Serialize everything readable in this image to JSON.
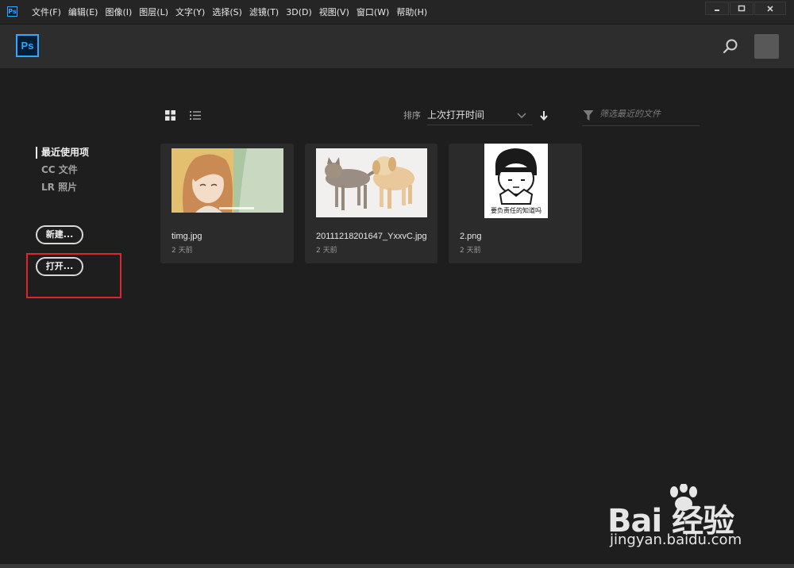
{
  "menubar": {
    "app_icon": "Ps",
    "items": [
      "文件(F)",
      "编辑(E)",
      "图像(I)",
      "图层(L)",
      "文字(Y)",
      "选择(S)",
      "滤镜(T)",
      "3D(D)",
      "视图(V)",
      "窗口(W)",
      "帮助(H)"
    ],
    "controls": [
      "minimize-icon",
      "maximize-icon",
      "close-icon"
    ]
  },
  "header": {
    "logo": "Ps",
    "icons": [
      "search-icon",
      "avatar"
    ]
  },
  "nav": {
    "items": [
      "最近使用项",
      "CC 文件",
      "LR 照片"
    ],
    "active_index": 0
  },
  "buttons": {
    "new_label": "新建...",
    "open_label": "打开..."
  },
  "toolbar": {
    "view_modes": [
      "grid-view-icon",
      "list-view-icon"
    ],
    "sort_label": "排序",
    "sort_value": "上次打开时间",
    "filter_placeholder": "筛选最近的文件"
  },
  "files": [
    {
      "name": "timg.jpg",
      "date": "2 天前"
    },
    {
      "name": "20111218201647_YxxvC.jpg",
      "date": "2 天前"
    },
    {
      "name": "2.png",
      "date": "2 天前"
    }
  ],
  "thumbnail_caption": "要负责任的知道吗",
  "watermark": {
    "brand": "Bai 经验",
    "url": "jingyan.baidu.com"
  },
  "colors": {
    "accent": "#31a8ff",
    "highlight_box": "#e0242b",
    "background": "#1e1e1e"
  }
}
